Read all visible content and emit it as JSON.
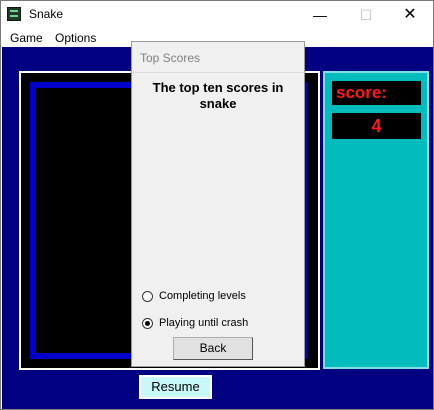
{
  "window": {
    "title": "Snake",
    "controls": {
      "minimize": "—",
      "maximize": "☐",
      "close": "✕"
    }
  },
  "menu": {
    "items": [
      "Game",
      "Options"
    ]
  },
  "game": {
    "score_label": "score:",
    "score_value": "4",
    "resume_label": "Resume"
  },
  "dialog": {
    "title": "Top Scores",
    "heading": "The top ten scores in snake",
    "options": [
      {
        "label": "Completing levels",
        "selected": false
      },
      {
        "label": "Playing until crash",
        "selected": true
      }
    ],
    "back_label": "Back"
  },
  "colors": {
    "background": "#000080",
    "wall": "#0000cc",
    "panel": "#00bcbc",
    "score_text": "#ff1a1a",
    "resume_button": "#c8f8f8"
  }
}
